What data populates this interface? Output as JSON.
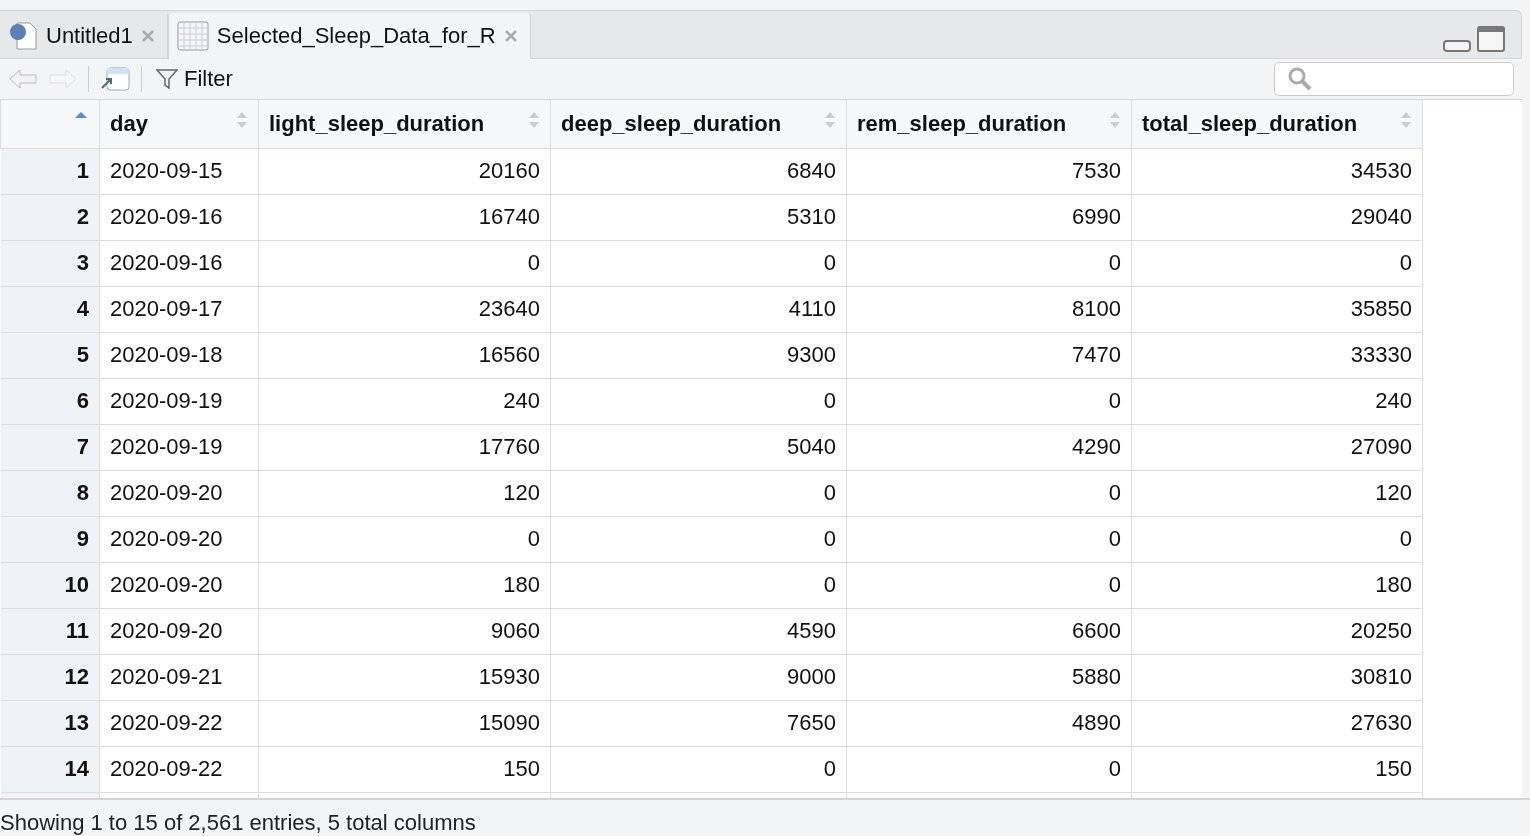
{
  "tabs": [
    {
      "label": "Untitled1",
      "kind": "script",
      "selected": false
    },
    {
      "label": "Selected_Sleep_Data_for_R",
      "kind": "data",
      "selected": true
    }
  ],
  "toolbar": {
    "filter_label": "Filter"
  },
  "table": {
    "columns": [
      {
        "sorted": true
      },
      {
        "label": "day",
        "sorted": false
      },
      {
        "label": "light_sleep_duration",
        "sorted": false
      },
      {
        "label": "deep_sleep_duration",
        "sorted": false
      },
      {
        "label": "rem_sleep_duration",
        "sorted": false
      },
      {
        "label": "total_sleep_duration",
        "sorted": false
      }
    ],
    "rows": [
      [
        "1",
        "2020-09-15",
        "20160",
        "6840",
        "7530",
        "34530"
      ],
      [
        "2",
        "2020-09-16",
        "16740",
        "5310",
        "6990",
        "29040"
      ],
      [
        "3",
        "2020-09-16",
        "0",
        "0",
        "0",
        "0"
      ],
      [
        "4",
        "2020-09-17",
        "23640",
        "4110",
        "8100",
        "35850"
      ],
      [
        "5",
        "2020-09-18",
        "16560",
        "9300",
        "7470",
        "33330"
      ],
      [
        "6",
        "2020-09-19",
        "240",
        "0",
        "0",
        "240"
      ],
      [
        "7",
        "2020-09-19",
        "17760",
        "5040",
        "4290",
        "27090"
      ],
      [
        "8",
        "2020-09-20",
        "120",
        "0",
        "0",
        "120"
      ],
      [
        "9",
        "2020-09-20",
        "0",
        "0",
        "0",
        "0"
      ],
      [
        "10",
        "2020-09-20",
        "180",
        "0",
        "0",
        "180"
      ],
      [
        "11",
        "2020-09-20",
        "9060",
        "4590",
        "6600",
        "20250"
      ],
      [
        "12",
        "2020-09-21",
        "15930",
        "9000",
        "5880",
        "30810"
      ],
      [
        "13",
        "2020-09-22",
        "15090",
        "7650",
        "4890",
        "27630"
      ],
      [
        "14",
        "2020-09-22",
        "150",
        "0",
        "0",
        "150"
      ]
    ]
  },
  "status_bar": "Showing 1 to 15 of 2,561 entries, 5 total columns"
}
